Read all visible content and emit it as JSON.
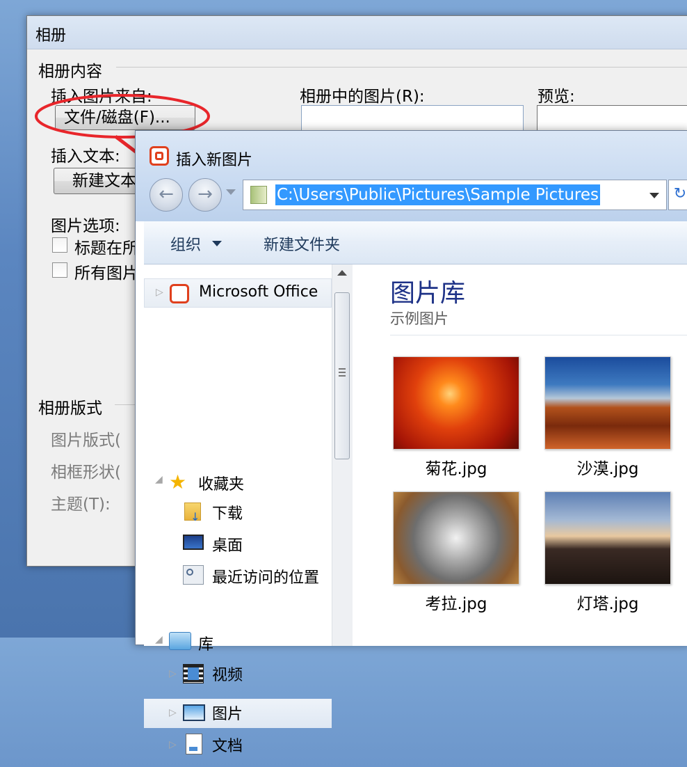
{
  "album_dialog": {
    "title": "相册",
    "album_content_group": "相册内容",
    "insert_picture_from": "插入图片来自:",
    "file_disk_button": "文件/磁盘(F)...",
    "pictures_in_album_label": "相册中的图片(R):",
    "preview_label": "预览:",
    "insert_text_label": "插入文本:",
    "new_textbox_button": "新建文本",
    "picture_options_label": "图片选项:",
    "caption_checkbox_label": "标题在所",
    "all_pictures_checkbox_label": "所有图片",
    "album_layout_group": "相册版式",
    "picture_layout_label": "图片版式(",
    "frame_shape_label": "相框形状(",
    "theme_label": "主题(T):"
  },
  "insert_dialog": {
    "title": "插入新图片",
    "back_arrow": "←",
    "forward_arrow": "→",
    "address_path": "C:\\Users\\Public\\Pictures\\Sample Pictures",
    "toolbar": {
      "organize": "组织",
      "new_folder": "新建文件夹"
    },
    "nav": {
      "microsoft_office": "Microsoft Office",
      "favorites": "收藏夹",
      "downloads": "下载",
      "desktop": "桌面",
      "recent_places": "最近访问的位置",
      "libraries": "库",
      "videos": "视频",
      "pictures": "图片",
      "documents": "文档"
    },
    "library": {
      "title": "图片库",
      "subtitle": "示例图片"
    },
    "files": [
      {
        "name": "菊花.jpg"
      },
      {
        "name": "沙漠.jpg"
      },
      {
        "name": "考拉.jpg"
      },
      {
        "name": "灯塔.jpg"
      }
    ]
  },
  "colors": {
    "highlight_circle": "#e8262b",
    "selection_blue": "#3399ff",
    "library_title": "#1e3287"
  }
}
